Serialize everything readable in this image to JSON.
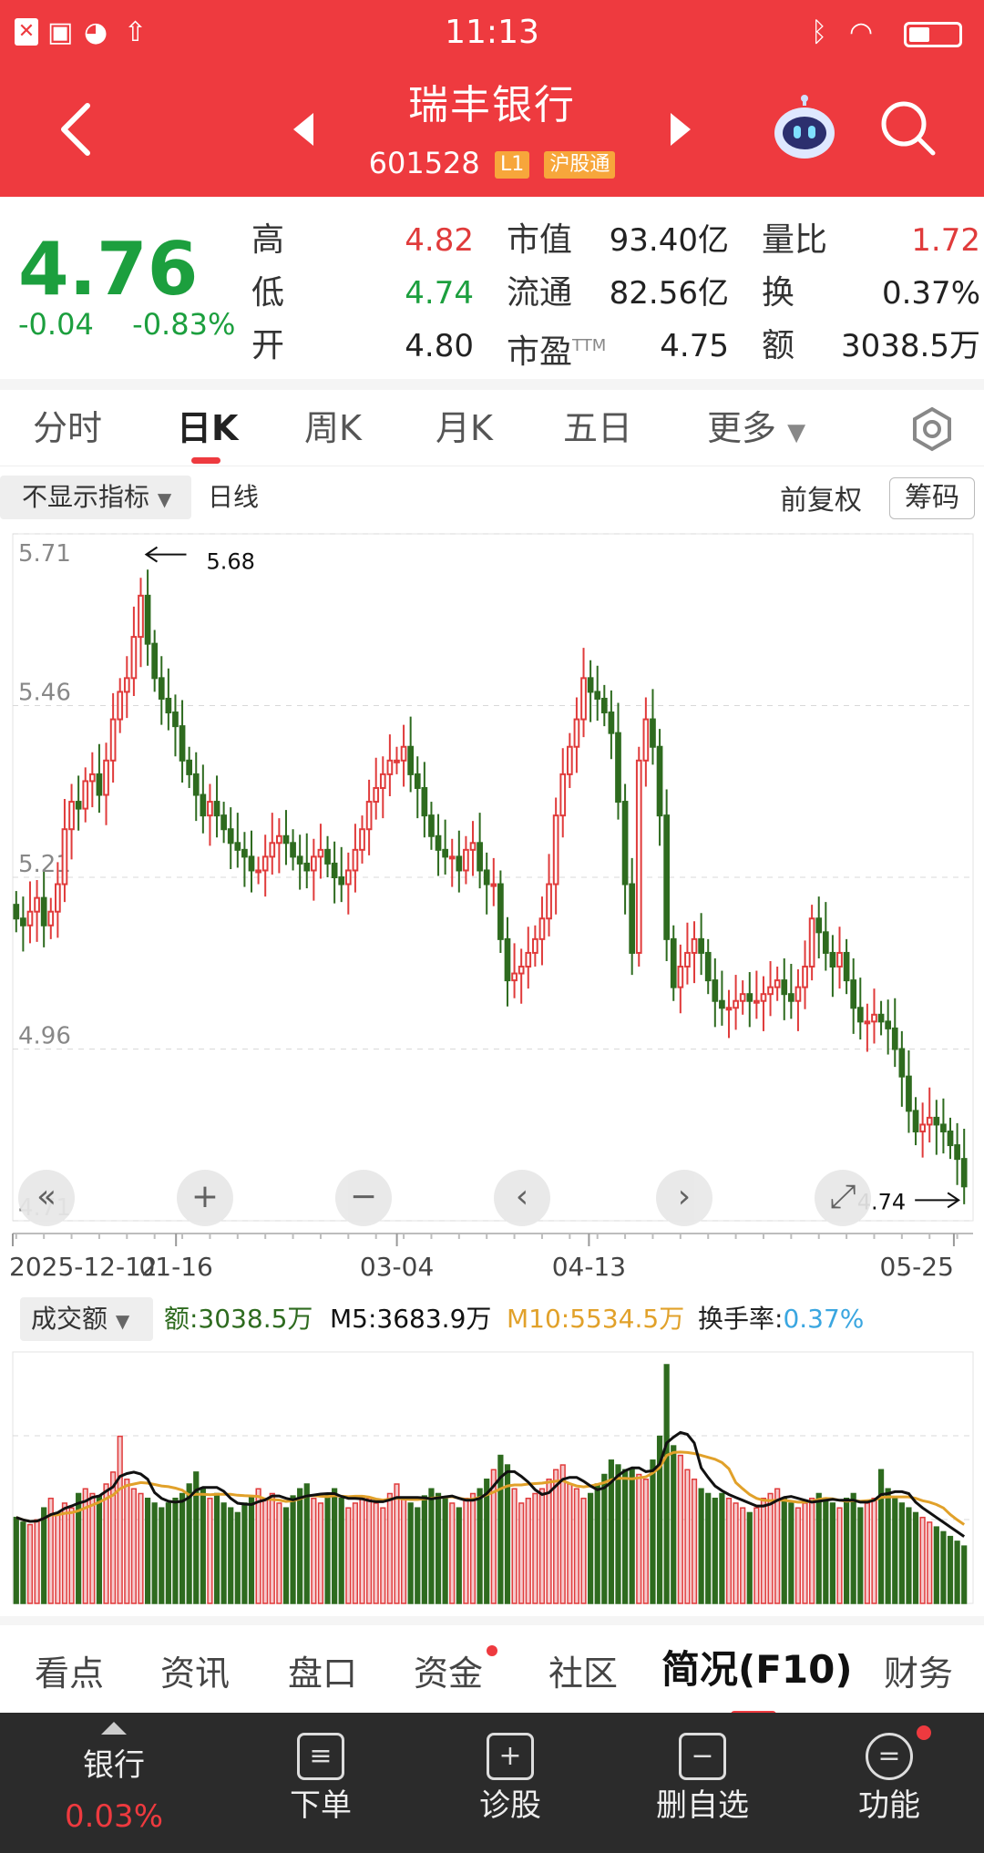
{
  "status_bar": {
    "time": "11:13"
  },
  "header": {
    "title": "瑞丰银行",
    "code": "601528",
    "level_tag": "L1",
    "market_tag": "沪股通"
  },
  "quote": {
    "price": "4.76",
    "change": "-0.04",
    "change_pct": "-0.83%",
    "fields": [
      {
        "label": "高",
        "value": "4.82",
        "color": "red"
      },
      {
        "label": "低",
        "value": "4.74",
        "color": "green"
      },
      {
        "label": "开",
        "value": "4.80",
        "color": "black"
      },
      {
        "label": "市值",
        "value": "93.40亿",
        "color": "black"
      },
      {
        "label": "流通",
        "value": "82.56亿",
        "color": "black"
      },
      {
        "label": "市盈TTM",
        "value": "4.75",
        "color": "black"
      },
      {
        "label": "量比",
        "value": "1.72",
        "color": "red"
      },
      {
        "label": "换",
        "value": "0.37%",
        "color": "black"
      },
      {
        "label": "额",
        "value": "3038.5万",
        "color": "black"
      }
    ]
  },
  "period_tabs": [
    "分时",
    "日K",
    "周K",
    "月K",
    "五日",
    "更多"
  ],
  "chart_toolbar": {
    "indicator": "不显示指标",
    "line_type": "日线",
    "adjust": "前复权",
    "chips": "筹码"
  },
  "chart_data": {
    "type": "candlestick",
    "y_ticks": [
      "5.71",
      "5.46",
      "5.21",
      "4.96",
      "4.71"
    ],
    "ylim": [
      4.71,
      5.71
    ],
    "x_ticks": [
      "2025-12-12",
      "01-16",
      "03-04",
      "04-13",
      "05-25"
    ],
    "high_marker": "5.68",
    "low_marker": "4.74",
    "up_color": "#e03b3b",
    "down_color": "#2e6b1f",
    "closes": [
      5.15,
      5.14,
      5.16,
      5.18,
      5.14,
      5.16,
      5.2,
      5.28,
      5.32,
      5.31,
      5.35,
      5.36,
      5.33,
      5.38,
      5.44,
      5.48,
      5.5,
      5.56,
      5.62,
      5.55,
      5.5,
      5.47,
      5.45,
      5.43,
      5.38,
      5.36,
      5.33,
      5.3,
      5.32,
      5.3,
      5.28,
      5.26,
      5.25,
      5.24,
      5.22,
      5.22,
      5.24,
      5.26,
      5.27,
      5.26,
      5.24,
      5.23,
      5.22,
      5.24,
      5.25,
      5.23,
      5.21,
      5.2,
      5.22,
      5.25,
      5.28,
      5.32,
      5.34,
      5.36,
      5.38,
      5.38,
      5.4,
      5.36,
      5.34,
      5.3,
      5.27,
      5.25,
      5.24,
      5.24,
      5.22,
      5.25,
      5.26,
      5.22,
      5.2,
      5.2,
      5.12,
      5.06,
      5.07,
      5.08,
      5.1,
      5.12,
      5.15,
      5.2,
      5.3,
      5.36,
      5.4,
      5.44,
      5.5,
      5.48,
      5.47,
      5.45,
      5.42,
      5.32,
      5.2,
      5.1,
      5.38,
      5.44,
      5.4,
      5.3,
      5.12,
      5.05,
      5.08,
      5.1,
      5.12,
      5.1,
      5.06,
      5.03,
      5.02,
      5.02,
      5.03,
      5.04,
      5.03,
      5.03,
      5.04,
      5.05,
      5.06,
      5.04,
      5.03,
      5.05,
      5.08,
      5.15,
      5.13,
      5.1,
      5.08,
      5.1,
      5.06,
      5.02,
      5.0,
      5.0,
      5.01,
      5.0,
      4.99,
      4.96,
      4.92,
      4.87,
      4.84,
      4.85,
      4.86,
      4.85,
      4.84,
      4.82,
      4.8,
      4.76
    ],
    "volume": {
      "label": "成交额",
      "amount": "额:3038.5万",
      "m5": "M5:3683.9万",
      "m10": "M10:5534.5万",
      "turnover_label": "换手率:",
      "turnover_value": "0.37%",
      "m5_color": "#111111",
      "m10_color": "#e1a12a",
      "values": [
        36,
        34,
        33,
        35,
        40,
        44,
        38,
        42,
        40,
        46,
        48,
        46,
        45,
        50,
        55,
        70,
        52,
        48,
        46,
        44,
        42,
        40,
        42,
        44,
        46,
        50,
        55,
        48,
        44,
        46,
        42,
        40,
        38,
        42,
        45,
        48,
        44,
        46,
        42,
        40,
        45,
        48,
        50,
        44,
        42,
        46,
        48,
        44,
        40,
        42,
        45,
        44,
        42,
        40,
        46,
        50,
        44,
        42,
        40,
        45,
        48,
        46,
        44,
        42,
        40,
        44,
        46,
        48,
        52,
        56,
        62,
        58,
        48,
        42,
        44,
        46,
        48,
        52,
        56,
        58,
        50,
        48,
        44,
        46,
        50,
        54,
        60,
        58,
        56,
        56,
        54,
        52,
        60,
        70,
        100,
        66,
        62,
        56,
        52,
        48,
        46,
        44,
        46,
        44,
        42,
        40,
        38,
        40,
        44,
        46,
        48,
        44,
        42,
        40,
        42,
        44,
        46,
        44,
        42,
        40,
        44,
        46,
        40,
        42,
        44,
        56,
        48,
        44,
        42,
        40,
        38,
        36,
        34,
        32,
        30,
        28,
        26,
        24
      ]
    }
  },
  "nav_buttons": [
    "«",
    "+",
    "−",
    "‹",
    "›",
    "⤢"
  ],
  "info_tabs": [
    "看点",
    "资讯",
    "盘口",
    "资金",
    "社区",
    "简况(F10)",
    "财务"
  ],
  "bottom_bar": [
    {
      "label": "银行",
      "sub": "0.03%"
    },
    {
      "label": "下单"
    },
    {
      "label": "诊股"
    },
    {
      "label": "删自选"
    },
    {
      "label": "功能"
    }
  ]
}
